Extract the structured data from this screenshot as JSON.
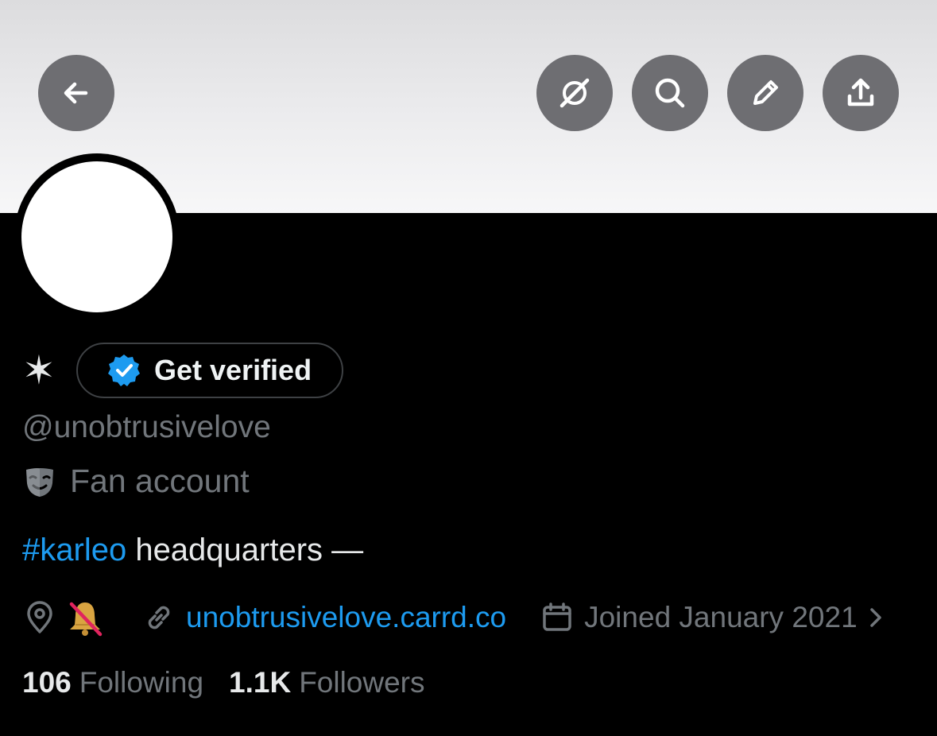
{
  "header": {
    "back_icon": "arrow-left-icon",
    "action_icons": [
      "grok-icon",
      "search-icon",
      "edit-icon",
      "share-icon"
    ]
  },
  "profile": {
    "display_name": "✶",
    "verify_label": "Get verified",
    "verify_badge_color": "#1d9bf0",
    "handle": "@unobtrusivelove",
    "category_icon": "theater-masks-icon",
    "category": "Fan account",
    "bio": {
      "hashtag": "#karleo",
      "text": " headquarters —"
    },
    "location_icon": "location-pin-icon",
    "location_emoji": "🔕",
    "website": "unobtrusivelove.carrd.co",
    "joined": "Joined January 2021",
    "following_count": "106",
    "following_label": "Following",
    "followers_count": "1.1K",
    "followers_label": "Followers"
  },
  "colors": {
    "accent": "#1d9bf0",
    "secondary_text": "#71767b",
    "primary_text": "#e7e9ea",
    "header_button": "#6e6e72"
  }
}
